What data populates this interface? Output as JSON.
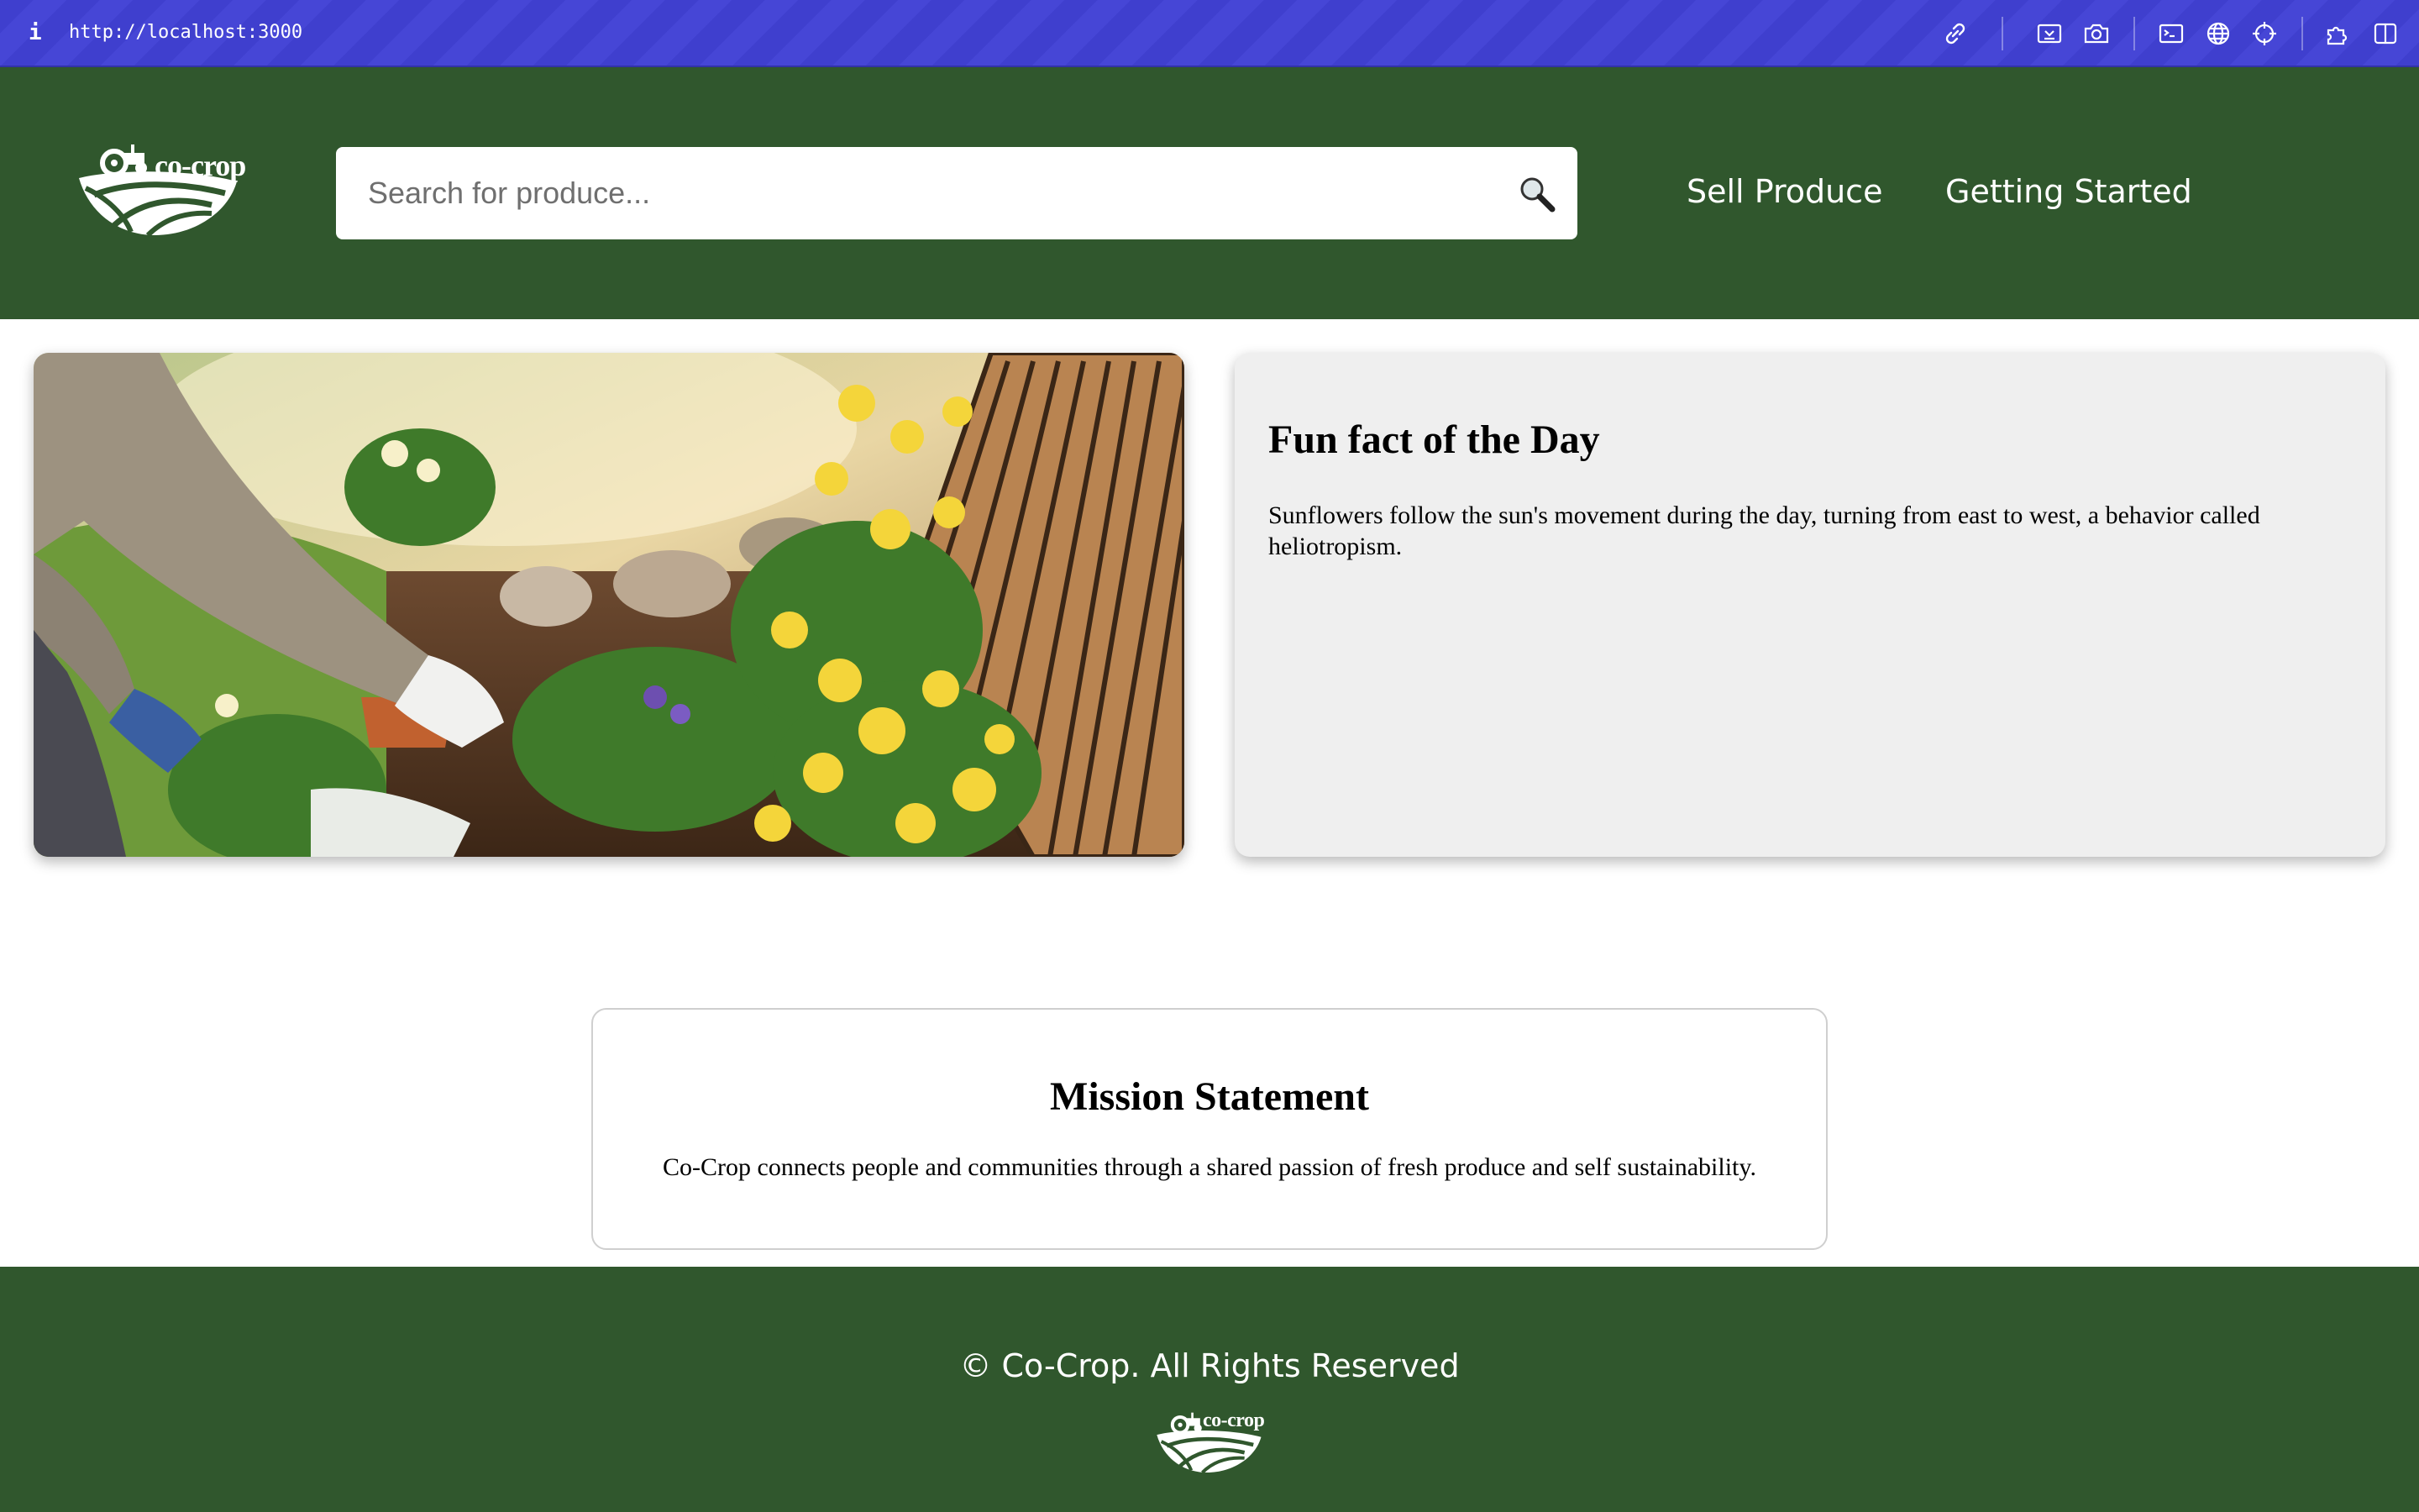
{
  "devbar": {
    "info_glyph": "i",
    "url": "http://localhost:3000",
    "tools": [
      "link-icon",
      "inspect-icon",
      "camera-icon",
      "terminal-icon",
      "globe-icon",
      "crosshair-icon",
      "extensions-icon",
      "split-panel-icon"
    ]
  },
  "header": {
    "logo_text": "co-crop",
    "search_placeholder": "Search for produce...",
    "search_value": "",
    "nav": {
      "sell": "Sell Produce",
      "getting_started": "Getting Started"
    }
  },
  "funfact": {
    "title": "Fun fact of the Day",
    "text": "Sunflowers follow the sun's movement during the day, turning from east to west, a behavior called heliotropism."
  },
  "mission": {
    "title": "Mission Statement",
    "text": "Co-Crop connects people and communities through a shared passion of fresh produce and self sustainability."
  },
  "footer": {
    "copyright": "© Co-Crop. All Rights Reserved",
    "logo_text": "co-crop"
  },
  "colors": {
    "brand_green": "#30572d",
    "devbar_blue": "#3f3fce",
    "card_gray": "#efefef"
  }
}
